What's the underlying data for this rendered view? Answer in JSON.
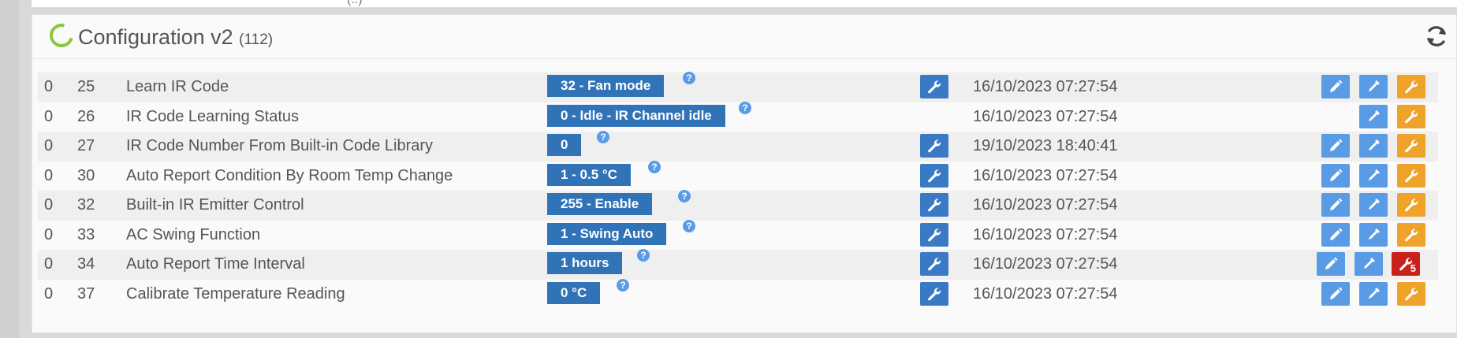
{
  "header": {
    "title": "Configuration v2",
    "count": "(112)",
    "prev_fragment": "(..)"
  },
  "rows": [
    {
      "inst": "0",
      "id": "25",
      "name": "Learn IR Code",
      "value": "32 - Fan mode",
      "date": "16/10/2023 07:27:54",
      "has_set": true,
      "has_edit": true,
      "wrench_alert": false,
      "badge": ""
    },
    {
      "inst": "0",
      "id": "26",
      "name": "IR Code Learning Status",
      "value": "0 - Idle - IR Channel idle",
      "date": "16/10/2023 07:27:54",
      "has_set": false,
      "has_edit": false,
      "wrench_alert": false,
      "badge": ""
    },
    {
      "inst": "0",
      "id": "27",
      "name": "IR Code Number From Built-in Code Library",
      "value": "0",
      "date": "19/10/2023 18:40:41",
      "has_set": true,
      "has_edit": true,
      "wrench_alert": false,
      "badge": ""
    },
    {
      "inst": "0",
      "id": "30",
      "name": "Auto Report Condition By Room Temp Change",
      "value": "1 - 0.5 °C",
      "date": "16/10/2023 07:27:54",
      "has_set": true,
      "has_edit": true,
      "wrench_alert": false,
      "badge": ""
    },
    {
      "inst": "0",
      "id": "32",
      "name": "Built-in IR Emitter Control",
      "value": "255 - Enable",
      "date": "16/10/2023 07:27:54",
      "has_set": true,
      "has_edit": true,
      "wrench_alert": false,
      "badge": ""
    },
    {
      "inst": "0",
      "id": "33",
      "name": "AC Swing Function",
      "value": "1 - Swing Auto",
      "date": "16/10/2023 07:27:54",
      "has_set": true,
      "has_edit": true,
      "wrench_alert": false,
      "badge": ""
    },
    {
      "inst": "0",
      "id": "34",
      "name": "Auto Report Time Interval",
      "value": "1 hours",
      "date": "16/10/2023 07:27:54",
      "has_set": true,
      "has_edit": true,
      "wrench_alert": true,
      "badge": "5"
    },
    {
      "inst": "0",
      "id": "37",
      "name": "Calibrate Temperature Reading",
      "value": "0 °C",
      "date": "16/10/2023 07:27:54",
      "has_set": true,
      "has_edit": true,
      "wrench_alert": false,
      "badge": ""
    }
  ],
  "icons": {
    "help": "?",
    "status": "status-ring-icon",
    "refresh": "refresh-icon",
    "set": "wrench-icon",
    "edit": "pencil-icon",
    "pipette": "pipette-icon",
    "config": "wrench-icon"
  },
  "colors": {
    "value_bg": "#3173b7",
    "edit_bg": "#5a9be6",
    "config_bg": "#f0a32a",
    "alert_bg": "#c8201a",
    "status_ring": "#8cc63f"
  }
}
